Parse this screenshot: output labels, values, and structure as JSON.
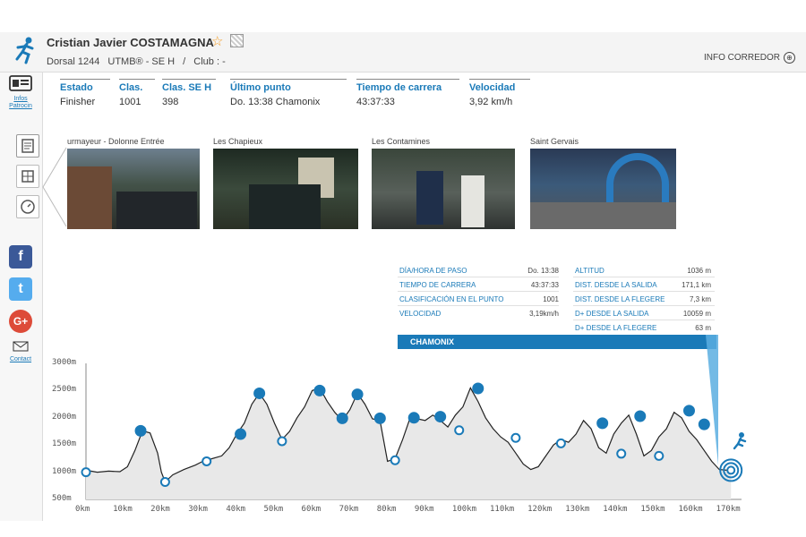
{
  "runner": {
    "name": "Cristian Javier COSTAMAGNA",
    "dorsal": "Dorsal 1244",
    "race": "UTMB® - SE H",
    "separator": "/",
    "club": "Club : -",
    "info_link": "INFO CORREDOR",
    "info_icon": "⊕"
  },
  "sidebar": {
    "infos_label": "Infos Patrocin",
    "contact_label": "Contact",
    "social": [
      {
        "name": "facebook",
        "glyph": "f",
        "color": "#3b5998"
      },
      {
        "name": "twitter",
        "glyph": "t",
        "color": "#55acee"
      },
      {
        "name": "google-plus",
        "glyph": "G+",
        "color": "#dd4b39"
      }
    ]
  },
  "stats": [
    {
      "label": "Estado",
      "value": "Finisher"
    },
    {
      "label": "Clas.",
      "value": "1001"
    },
    {
      "label": "Clas. SE H",
      "value": "398"
    },
    {
      "label": "Último punto",
      "value": "Do. 13:38  Chamonix"
    },
    {
      "label": "Tiempo de carrera",
      "value": "43:37:33"
    },
    {
      "label": "Velocidad",
      "value": "3,92 km/h"
    }
  ],
  "photos": [
    {
      "caption": "urmayeur - Dolonne Entrée"
    },
    {
      "caption": "Les Chapieux"
    },
    {
      "caption": "Les Contamines"
    },
    {
      "caption": "Saint Gervais"
    }
  ],
  "point_info": {
    "left": [
      {
        "label": "DÍA/HORA DE PASO",
        "value": "Do. 13:38"
      },
      {
        "label": "TIEMPO DE CARRERA",
        "value": "43:37:33"
      },
      {
        "label": "CLASIFICACIÓN EN EL PUNTO",
        "value": "1001"
      },
      {
        "label": "VELOCIDAD",
        "value": "3,19km/h"
      }
    ],
    "right": [
      {
        "label": "ALTITUD",
        "value": "1036 m"
      },
      {
        "label": "DIST. DESDE LA SALIDA",
        "value": "171,1 km"
      },
      {
        "label": "DIST. DESDE LA FLEGERE",
        "value": "7,3 km"
      },
      {
        "label": "D+ DESDE LA SALIDA",
        "value": "10059 m"
      },
      {
        "label": "D+ DESDE LA FLEGERE",
        "value": "63 m"
      }
    ],
    "point_name": "CHAMONIX"
  },
  "colors": {
    "accent": "#1a7ab8",
    "profile_fill": "#e8e8e8",
    "profile_line": "#222222",
    "marker": "#1a7ab8"
  },
  "chart_data": {
    "type": "area",
    "xlabel": "",
    "ylabel": "",
    "xlim": [
      0,
      172
    ],
    "ylim": [
      500,
      3000
    ],
    "x_ticks": [
      "0km",
      "10km",
      "20km",
      "30km",
      "40km",
      "50km",
      "60km",
      "70km",
      "80km",
      "90km",
      "100km",
      "110km",
      "120km",
      "130km",
      "140km",
      "150km",
      "160km",
      "170km"
    ],
    "y_ticks": [
      "500m",
      "1000m",
      "1500m",
      "2000m",
      "2500m",
      "3000m"
    ],
    "profile": {
      "x": [
        0,
        3,
        6,
        9,
        11,
        13,
        15,
        17,
        19,
        20,
        21,
        23,
        26,
        29,
        31,
        33,
        36,
        38,
        40,
        42,
        44,
        46,
        48,
        50,
        52,
        54,
        56,
        58,
        60,
        62,
        64,
        66,
        68,
        70,
        72,
        74,
        76,
        78,
        80,
        82,
        84,
        86,
        88,
        90,
        92,
        94,
        96,
        98,
        100,
        102,
        104,
        106,
        108,
        110,
        112,
        114,
        116,
        118,
        120,
        122,
        124,
        126,
        128,
        130,
        132,
        134,
        136,
        138,
        140,
        142,
        144,
        146,
        148,
        150,
        152,
        154,
        156,
        158,
        160,
        162,
        164,
        166,
        168,
        170,
        171.1
      ],
      "y": [
        1036,
        1000,
        1020,
        1010,
        1100,
        1400,
        1760,
        1720,
        1350,
        1000,
        820,
        950,
        1050,
        1130,
        1200,
        1240,
        1300,
        1450,
        1700,
        1900,
        2250,
        2450,
        2250,
        1900,
        1600,
        1750,
        2000,
        2200,
        2500,
        2550,
        2300,
        2100,
        1950,
        2150,
        2450,
        2250,
        1980,
        1950,
        1200,
        1250,
        1600,
        2000,
        1980,
        1950,
        2050,
        1950,
        1830,
        2050,
        2200,
        2550,
        2300,
        2000,
        1800,
        1650,
        1550,
        1350,
        1150,
        1050,
        1100,
        1300,
        1500,
        1600,
        1550,
        1700,
        1950,
        1800,
        1450,
        1350,
        1700,
        1900,
        2050,
        1700,
        1300,
        1400,
        1650,
        1800,
        2100,
        2000,
        1750,
        1600,
        1400,
        1200,
        1050,
        1036,
        1036
      ]
    },
    "markers": [
      {
        "x": 0,
        "y": 1000,
        "kind": "open"
      },
      {
        "x": 14.5,
        "y": 1760,
        "kind": "filled"
      },
      {
        "x": 21,
        "y": 820,
        "kind": "open"
      },
      {
        "x": 32,
        "y": 1200,
        "kind": "open"
      },
      {
        "x": 41,
        "y": 1700,
        "kind": "filled"
      },
      {
        "x": 46,
        "y": 2450,
        "kind": "filled"
      },
      {
        "x": 52,
        "y": 1570,
        "kind": "open"
      },
      {
        "x": 62,
        "y": 2500,
        "kind": "filled"
      },
      {
        "x": 68,
        "y": 1990,
        "kind": "filled"
      },
      {
        "x": 72,
        "y": 2430,
        "kind": "filled"
      },
      {
        "x": 78,
        "y": 1990,
        "kind": "filled"
      },
      {
        "x": 82,
        "y": 1220,
        "kind": "open"
      },
      {
        "x": 87,
        "y": 2000,
        "kind": "filled"
      },
      {
        "x": 94,
        "y": 2020,
        "kind": "filled"
      },
      {
        "x": 99,
        "y": 1770,
        "kind": "open"
      },
      {
        "x": 104,
        "y": 2540,
        "kind": "filled"
      },
      {
        "x": 114,
        "y": 1630,
        "kind": "open"
      },
      {
        "x": 126,
        "y": 1530,
        "kind": "open"
      },
      {
        "x": 137,
        "y": 1900,
        "kind": "filled"
      },
      {
        "x": 142,
        "y": 1340,
        "kind": "open"
      },
      {
        "x": 147,
        "y": 2030,
        "kind": "filled"
      },
      {
        "x": 152,
        "y": 1300,
        "kind": "open"
      },
      {
        "x": 160,
        "y": 2130,
        "kind": "filled"
      },
      {
        "x": 164,
        "y": 1880,
        "kind": "filled"
      },
      {
        "x": 171.1,
        "y": 1036,
        "kind": "target"
      }
    ],
    "grid": false
  }
}
